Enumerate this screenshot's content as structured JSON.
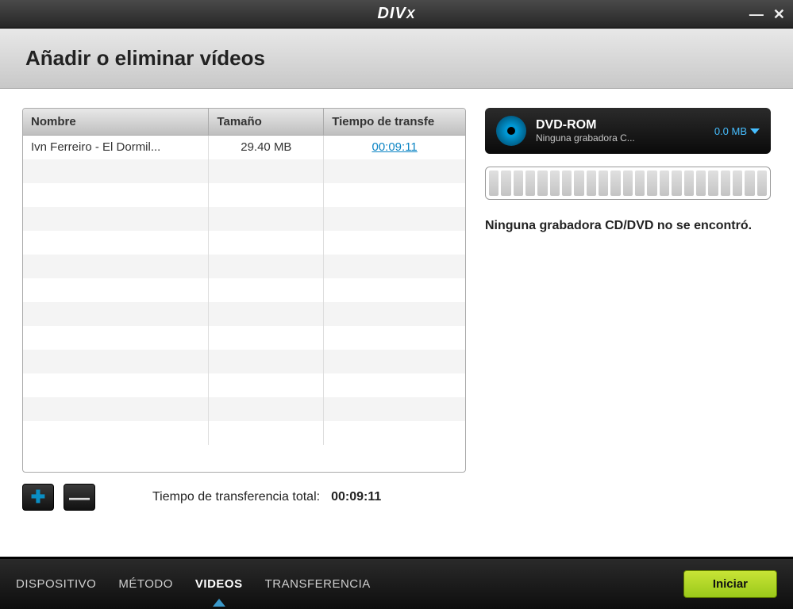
{
  "app": {
    "logo_main": "DIV",
    "logo_x": "X"
  },
  "header": {
    "title": "Añadir o eliminar vídeos"
  },
  "table": {
    "headers": {
      "name": "Nombre",
      "size": "Tamaño",
      "transfer": "Tiempo de transfe"
    },
    "rows": [
      {
        "name": "Ivn Ferreiro - El Dormil...",
        "size": "29.40 MB",
        "time": "00:09:11"
      }
    ]
  },
  "totals": {
    "label": "Tiempo de transferencia total:",
    "value": "00:09:11"
  },
  "device": {
    "name": "DVD-ROM",
    "sub": "Ninguna grabadora C...",
    "size": "0.0 MB"
  },
  "status": "Ninguna grabadora CD/DVD no se encontró.",
  "footer": {
    "tabs": {
      "device": "DISPOSITIVO",
      "method": "MÉTODO",
      "videos": "VIDEOS",
      "transfer": "TRANSFERENCIA"
    },
    "start": "Iniciar"
  }
}
